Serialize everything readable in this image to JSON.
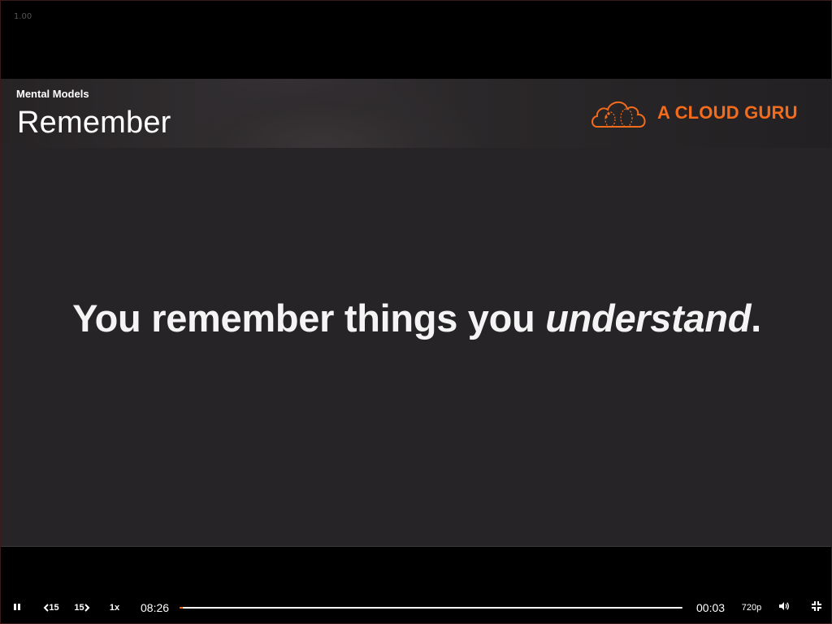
{
  "player": {
    "speed_readout": "1.00"
  },
  "slide": {
    "subtitle": "Mental Models",
    "title": "Remember",
    "brand": "A CLOUD GURU",
    "quote_main": "You remember things you ",
    "quote_emphasis": "understand",
    "quote_end": "."
  },
  "controls": {
    "rewind_label": "15",
    "forward_label": "15",
    "speed_label": "1x",
    "duration": "08:26",
    "current_time": "00:03",
    "quality": "720p",
    "progress_fraction": 0.006
  },
  "colors": {
    "brand": "#f46b1c",
    "slide_background": "#272427",
    "player_background": "#000000"
  },
  "icons": {
    "pause": "pause-icon",
    "rewind": "rewind-15-icon",
    "forward": "forward-15-icon",
    "volume": "volume-icon",
    "exit_fullscreen": "exit-fullscreen-icon",
    "logo": "cloud-logo-icon"
  }
}
